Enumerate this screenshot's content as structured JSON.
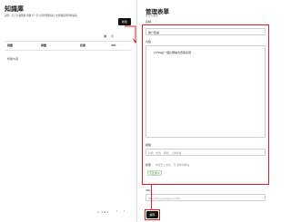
{
  "left": {
    "title": "知識庫",
    "description": "說明：這下方載體層 標籤 行 / 列 可新增刪除與上架標籤與列資料編輯。",
    "create_button": "新建",
    "toolbar": {
      "grid_icon": "grid-icon",
      "settings_icon": "gear-icon"
    },
    "columns": [
      "標籤",
      "標籤",
      "狀態",
      "URL"
    ],
    "empty_text": "暫無內容",
    "pagination": "1 - 1 of 1"
  },
  "right": {
    "title": "管理表單",
    "subtitle": "建立知識庫",
    "name_label": "名稱",
    "name_value": "簡介知識",
    "content_label": "內容",
    "content_value": "FCSN是一個比賽綜合查閱系統……",
    "tags_label": "標籤",
    "tags_placeholder": "新增、修改、刪除、上傳標籤……",
    "status_label": "狀態",
    "status_hint": "勾選已上架者，可 發佈到網站",
    "status_tag": "已上架",
    "url_label": "URL",
    "url_value": "https://fcsn.example.com/kb/",
    "save_button": "儲存"
  },
  "colors": {
    "highlight": "#e02020",
    "button": "#111111"
  }
}
